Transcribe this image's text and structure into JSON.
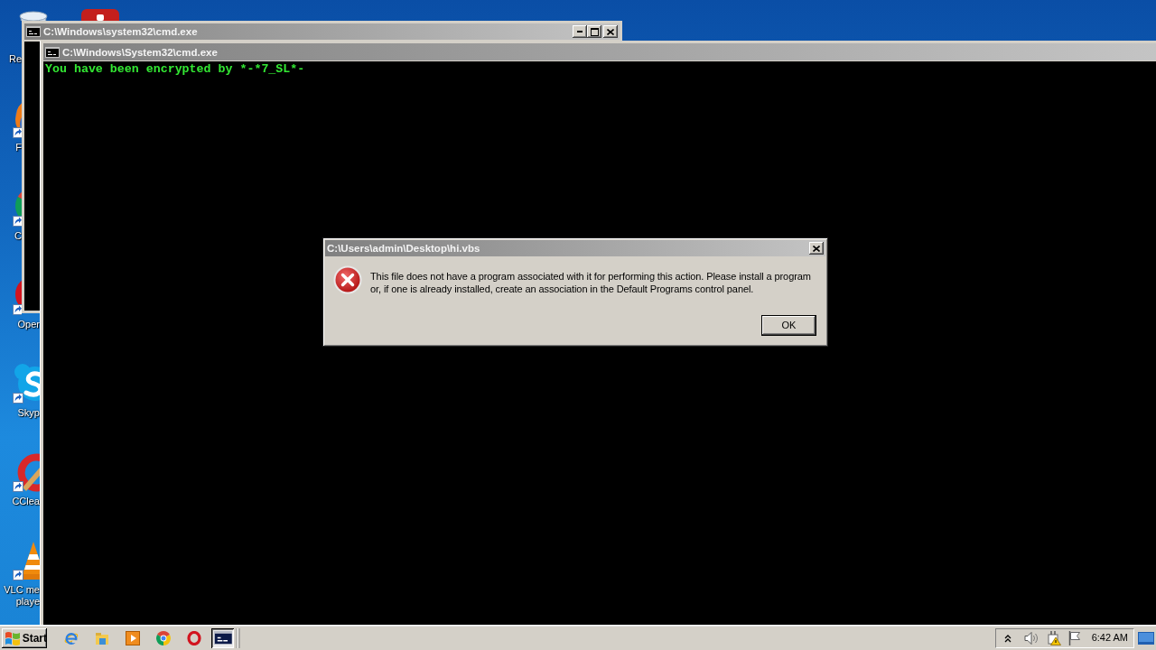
{
  "desktop": {
    "icons": [
      {
        "kind": "trash",
        "label": [
          "Re"
        ]
      },
      {
        "kind": "fox",
        "label": [
          "F"
        ]
      },
      {
        "kind": "wheel",
        "label": [
          "C"
        ]
      },
      {
        "kind": "ring",
        "label": [
          "Oper"
        ]
      },
      {
        "kind": "bubble",
        "label": [
          "Skyp"
        ]
      },
      {
        "kind": "brush",
        "label": [
          "CClea"
        ]
      },
      {
        "kind": "cone",
        "label": [
          "VLC me",
          "playe"
        ]
      },
      {
        "kind": "tile"
      }
    ]
  },
  "windows": [
    {
      "title": "C:\\Windows\\system32\\cmd.exe"
    },
    {
      "title": "C:\\Windows\\System32\\cmd.exe",
      "lines": [
        "You have been encrypted by *-*7_SL*-"
      ]
    }
  ],
  "dialog": {
    "title": "C:\\Users\\admin\\Desktop\\hi.vbs",
    "message": "This file does not have a program associated with it for performing this action. Please install a program or, if one is already installed, create an association in the Default Programs control panel.",
    "buttons": [
      {
        "label": "OK",
        "default": true
      }
    ]
  },
  "taskbar": {
    "start": "Start",
    "tasks": [
      {
        "selected": true
      }
    ],
    "clock": "6:42 AM"
  }
}
